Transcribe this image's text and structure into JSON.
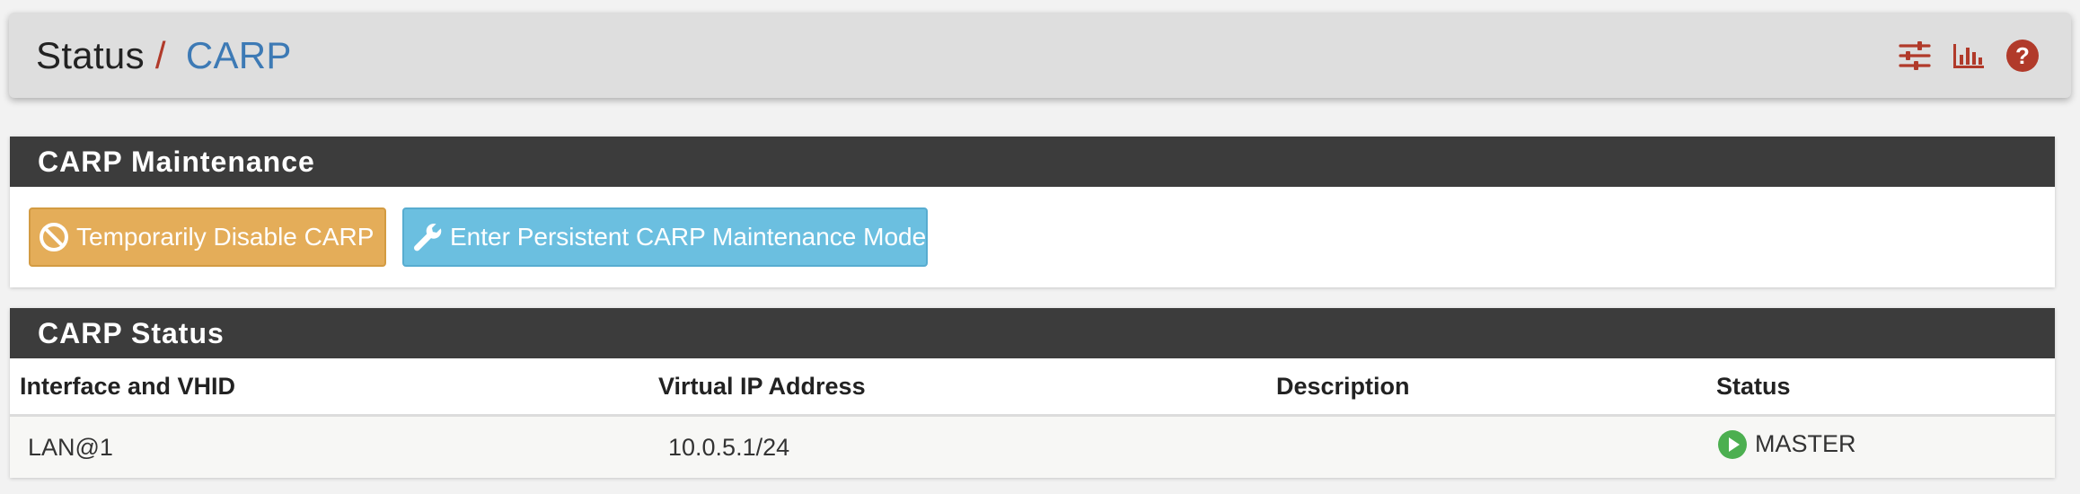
{
  "breadcrumb": {
    "section": "Status",
    "separator": "/",
    "page": "CARP"
  },
  "header_icons": [
    "sliders-icon",
    "bar-chart-icon",
    "help-icon"
  ],
  "colors": {
    "accent_red": "#b13a2a",
    "link_blue": "#3d7ab5",
    "panel_heading": "#3c3c3c",
    "warning": "#e4ad59",
    "info": "#6bbfe0",
    "master_green": "#4caf50"
  },
  "maintenance": {
    "title": "CARP Maintenance",
    "disable_button": "Temporarily Disable CARP",
    "disable_icon": "ban-icon",
    "persistent_button": "Enter Persistent CARP Maintenance Mode",
    "persistent_icon": "wrench-icon"
  },
  "status": {
    "title": "CARP Status",
    "columns": [
      "Interface and VHID",
      "Virtual IP Address",
      "Description",
      "Status"
    ],
    "rows": [
      {
        "interface": "LAN@1",
        "vip": "10.0.5.1/24",
        "description": "",
        "status": "MASTER",
        "status_icon": "play-circle-icon"
      }
    ]
  }
}
